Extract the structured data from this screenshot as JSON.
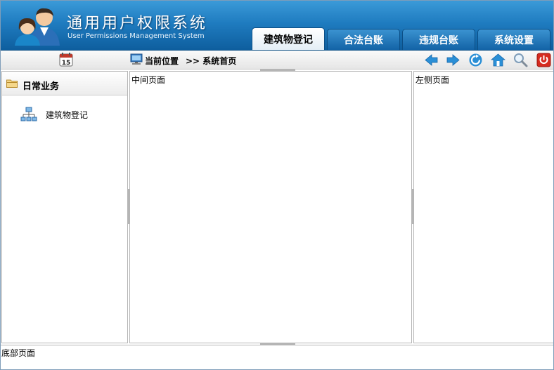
{
  "app": {
    "title": "通用用户权限系统",
    "subtitle": "User Permissions Management System"
  },
  "tabs": [
    {
      "label": "建筑物登记",
      "active": true
    },
    {
      "label": "合法台账",
      "active": false
    },
    {
      "label": "违规台账",
      "active": false
    },
    {
      "label": "系统设置",
      "active": false
    }
  ],
  "toolbar": {
    "calendar_day": "15",
    "location_label": "当前位置",
    "location_path": ">> 系统首页",
    "buttons": [
      "back-icon",
      "forward-icon",
      "refresh-icon",
      "home-icon",
      "search-icon",
      "power-icon"
    ]
  },
  "sidebar": {
    "title": "日常业务",
    "items": [
      {
        "label": "建筑物登记",
        "icon": "tree-icon"
      }
    ]
  },
  "middle": {
    "text": "中间页面"
  },
  "right": {
    "text": "左侧页面"
  },
  "footer": {
    "text": "底部页面"
  },
  "colors": {
    "header_blue": "#1f7cc0",
    "arrow_blue": "#2a8fd6",
    "power_red": "#d62b1f"
  }
}
